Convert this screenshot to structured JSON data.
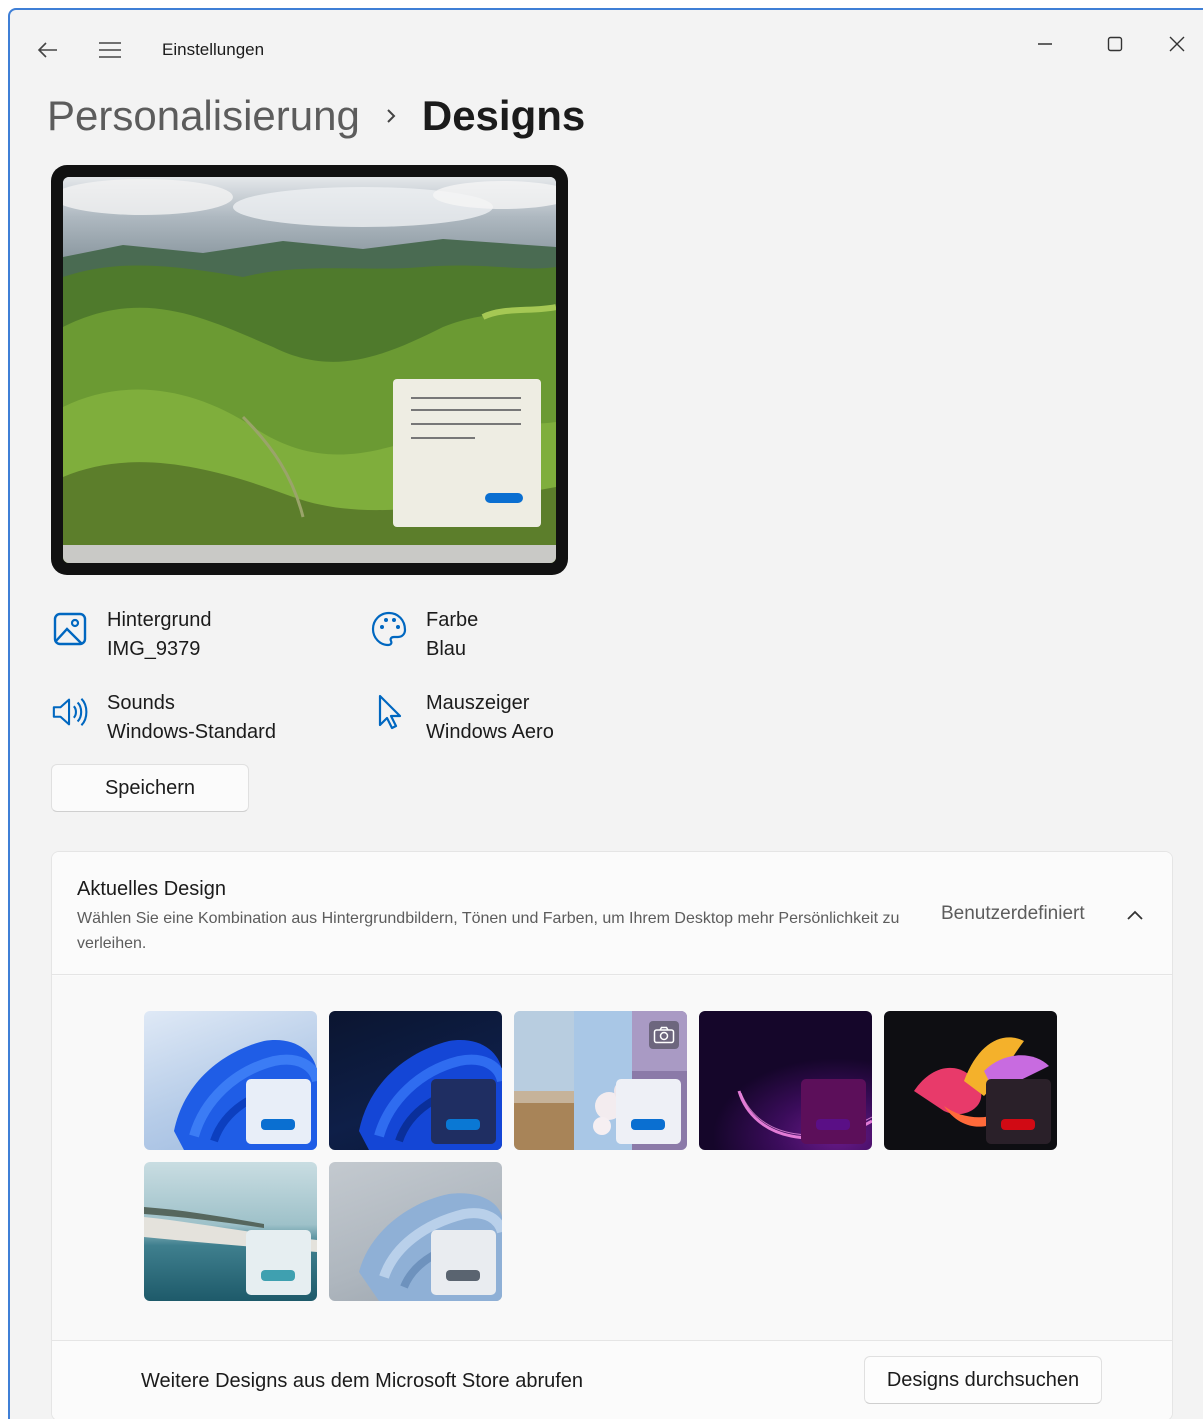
{
  "app": {
    "title": "Einstellungen"
  },
  "breadcrumb": {
    "parent": "Personalisierung",
    "current": "Designs"
  },
  "info": {
    "background": {
      "label": "Hintergrund",
      "value": "IMG_9379",
      "icon": "image-icon"
    },
    "color": {
      "label": "Farbe",
      "value": "Blau",
      "icon": "palette-icon"
    },
    "sounds": {
      "label": "Sounds",
      "value": "Windows-Standard",
      "icon": "speaker-icon"
    },
    "cursor": {
      "label": "Mauszeiger",
      "value": "Windows Aero",
      "icon": "cursor-icon"
    }
  },
  "save_label": "Speichern",
  "current_design": {
    "title": "Aktuelles Design",
    "description": "Wählen Sie eine Kombination aus Hintergrundbildern, Tönen und Farben, um Ihrem Desktop mehr Persönlichkeit zu verleihen.",
    "status": "Benutzerdefiniert"
  },
  "themes": [
    {
      "name": "windows-light",
      "accent": "#0a6fd1",
      "mini_bg": "#e8eef8"
    },
    {
      "name": "windows-dark",
      "accent": "#0a78d4",
      "mini_bg": "#1f2e62"
    },
    {
      "name": "windows-spotlight",
      "accent": "#0a6fd1",
      "mini_bg": "#eef0f6"
    },
    {
      "name": "glow",
      "accent": "#5a0f86",
      "mini_bg": "#5c0f5a"
    },
    {
      "name": "captured-motion",
      "accent": "#d10a14",
      "mini_bg": "#2a2029"
    },
    {
      "name": "flow",
      "accent": "#3fa0b0",
      "mini_bg": "#e6eef1"
    },
    {
      "name": "sunrise",
      "accent": "#5a6470",
      "mini_bg": "#e9ecf0"
    }
  ],
  "footer": {
    "text": "Weitere Designs aus dem Microsoft Store abrufen",
    "button": "Designs durchsuchen"
  },
  "colors": {
    "accent": "#0067c0",
    "window_bg": "#f3f3f3",
    "card_bg": "#fbfbfb"
  }
}
